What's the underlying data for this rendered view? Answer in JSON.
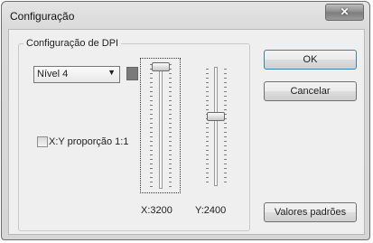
{
  "window": {
    "title": "Configuração",
    "close_glyph": "✕"
  },
  "group": {
    "label": "Configuração de DPI",
    "level_select": {
      "value": "Nível 4",
      "arrow_icon": "chevron-down-icon"
    },
    "swatch_color": "#7a7a7a",
    "aspect_checkbox": {
      "label": "X:Y proporção 1:1",
      "checked": false
    },
    "x_slider": {
      "label": "X:3200",
      "level": 1.0
    },
    "y_slider": {
      "label": "Y:2400",
      "level": 0.6
    }
  },
  "buttons": {
    "ok": "OK",
    "cancel": "Cancelar",
    "defaults": "Valores padrões"
  }
}
